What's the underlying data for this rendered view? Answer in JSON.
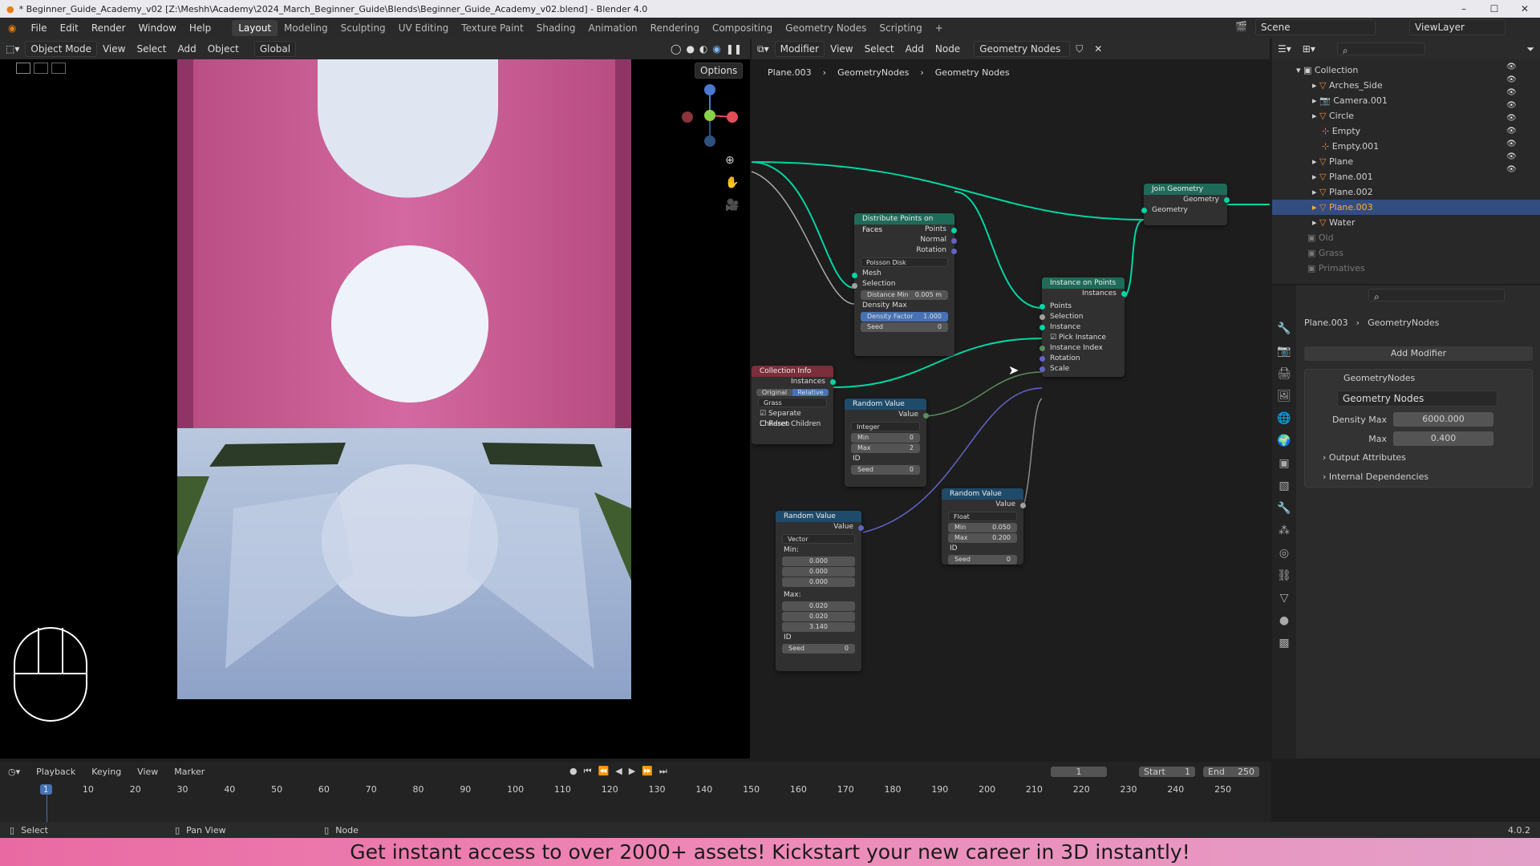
{
  "window": {
    "title": "* Beginner_Guide_Academy_v02 [Z:\\Meshh\\Academy\\2024_March_Beginner_Guide\\Blends\\Beginner_Guide_Academy_v02.blend] - Blender 4.0",
    "min": "–",
    "max": "☐",
    "close": "✕"
  },
  "menu": [
    "File",
    "Edit",
    "Render",
    "Window",
    "Help"
  ],
  "workspaces": [
    "Layout",
    "Modeling",
    "Sculpting",
    "UV Editing",
    "Texture Paint",
    "Shading",
    "Animation",
    "Rendering",
    "Compositing",
    "Geometry Nodes",
    "Scripting"
  ],
  "workspace_add": "+",
  "scene": "Scene",
  "viewlayer": "ViewLayer",
  "viewport_header": {
    "mode": "Object Mode",
    "items": [
      "View",
      "Select",
      "Add",
      "Object"
    ],
    "transform": "Global",
    "options": "Options"
  },
  "node_header": {
    "editor": "Modifier",
    "items": [
      "View",
      "Select",
      "Add",
      "Node"
    ],
    "tree": "Geometry Nodes"
  },
  "breadcrumb": [
    "Plane.003",
    "GeometryNodes",
    "Geometry Nodes"
  ],
  "nodes": {
    "distribute": {
      "title": "Distribute Points on Faces",
      "out_points": "Points",
      "out_normal": "Normal",
      "out_rotation": "Rotation",
      "method": "Poisson Disk",
      "mesh": "Mesh",
      "selection": "Selection",
      "dist_label": "Distance Min",
      "dist_val": "0.005 m",
      "density_max": "Density Max",
      "df_label": "Density Factor",
      "df_val": "1.000",
      "seed_label": "Seed",
      "seed_val": "0"
    },
    "join": {
      "title": "Join Geometry",
      "out": "Geometry",
      "in": "Geometry"
    },
    "instance": {
      "title": "Instance on Points",
      "out": "Instances",
      "points": "Points",
      "selection": "Selection",
      "instance": "Instance",
      "pick": "Pick Instance",
      "index": "Instance Index",
      "rotation": "Rotation",
      "scale": "Scale"
    },
    "collection": {
      "title": "Collection Info",
      "out": "Instances",
      "original": "Original",
      "relative": "Relative",
      "coll": "Grass",
      "separate": "Separate Children",
      "reset": "Reset Children"
    },
    "rand_int": {
      "title": "Random Value",
      "out": "Value",
      "type": "Integer",
      "min_label": "Min",
      "min_val": "0",
      "max_label": "Max",
      "max_val": "2",
      "id": "ID",
      "seed_label": "Seed",
      "seed_val": "0"
    },
    "rand_float": {
      "title": "Random Value",
      "out": "Value",
      "type": "Float",
      "min_label": "Min",
      "min_val": "0.050",
      "max_label": "Max",
      "max_val": "0.200",
      "id": "ID",
      "seed_label": "Seed",
      "seed_val": "0"
    },
    "rand_vec": {
      "title": "Random Value",
      "out": "Value",
      "type": "Vector",
      "min_label": "Min:",
      "min": [
        "0.000",
        "0.000",
        "0.000"
      ],
      "max_label": "Max:",
      "max": [
        "0.020",
        "0.020",
        "3.140"
      ],
      "id": "ID",
      "seed_label": "Seed",
      "seed_val": "0"
    }
  },
  "outliner": {
    "root": "Collection",
    "items": [
      "Arches_Side",
      "Camera.001",
      "Circle",
      "Empty",
      "Empty.001",
      "Plane",
      "Plane.001",
      "Plane.002",
      "Plane.003",
      "Water"
    ],
    "sub": [
      "Old",
      "Grass",
      "Primatives"
    ]
  },
  "properties": {
    "crumb": [
      "Plane.003",
      "GeometryNodes"
    ],
    "add_modifier": "Add Modifier",
    "modifier": "GeometryNodes",
    "group": "Geometry Nodes",
    "fields": [
      {
        "label": "Density Max",
        "value": "6000.000"
      },
      {
        "label": "Max",
        "value": "0.400"
      }
    ],
    "sections": [
      "Output Attributes",
      "Internal Dependencies"
    ]
  },
  "timeline": {
    "menus": [
      "Playback",
      "Keying",
      "View",
      "Marker"
    ],
    "frame": "1",
    "start_label": "Start",
    "start": "1",
    "end_label": "End",
    "end": "250",
    "ticks": [
      "1",
      "10",
      "20",
      "30",
      "40",
      "50",
      "60",
      "70",
      "80",
      "90",
      "100",
      "110",
      "120",
      "130",
      "140",
      "150",
      "160",
      "170",
      "180",
      "190",
      "200",
      "210",
      "220",
      "230",
      "240",
      "250"
    ]
  },
  "status": {
    "select": "Select",
    "pan": "Pan View",
    "node": "Node",
    "version": "4.0.2"
  },
  "banner": "Get instant access to over 2000+ assets! Kickstart your new career in 3D instantly!"
}
